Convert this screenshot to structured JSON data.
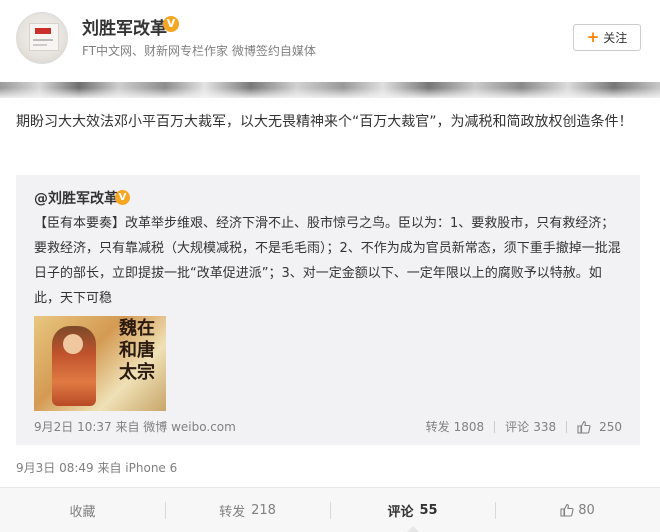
{
  "header": {
    "username": "刘胜军改革",
    "verified_badge": "V",
    "bio": "FT中文网、财新网专栏作家 微博签约自媒体",
    "follow_label": "关注"
  },
  "post": {
    "text": "期盼习大大效法邓小平百万大裁军，以大无畏精神来个“百万大裁官”，为减税和简政放权创造条件！",
    "time_source": "9月3日 08:49 来自 iPhone 6"
  },
  "quoted": {
    "mention": "@刘胜军改革",
    "verified_badge": "V",
    "text": "【臣有本要奏】改革举步维艰、经济下滑不止、股市惊弓之鸟。臣以为：1、要救股市，只有救经济；要救经济，只有靠减税（大规模减税，不是毛毛雨）；2、不作为成为官员新常态，须下重手撤掉一批混日子的部长，立即提拔一批“改革促进派”；3、对一定金额以下、一定年限以上的腐败予以特赦。如此，天下可稳",
    "image_text": "魏在和唐太宗",
    "time_source": "9月2日 10:37 来自 微博 weibo.com",
    "repost_label": "转发",
    "repost_count": "1808",
    "comment_label": "评论",
    "comment_count": "338",
    "like_count": "250"
  },
  "bottom_bar": {
    "favorite_label": "收藏",
    "repost_label": "转发",
    "repost_count": "218",
    "comment_label": "评论",
    "comment_count": "55",
    "like_count": "80"
  },
  "colors": {
    "accent_orange": "#ff8200",
    "verified_gold": "#f5a623",
    "quote_bg": "#f2f2f5",
    "meta_gray": "#808080"
  }
}
